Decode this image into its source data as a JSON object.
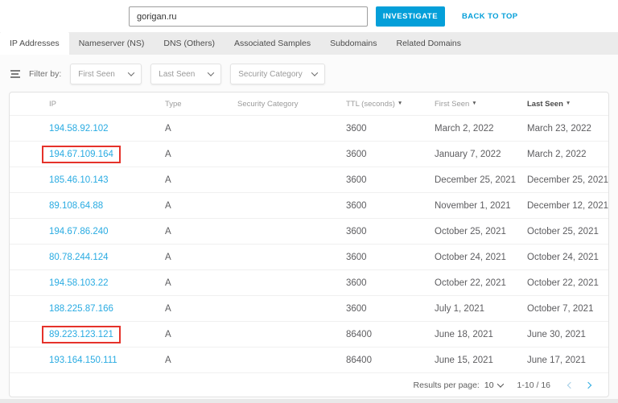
{
  "topbar": {
    "search_value": "gorigan.ru",
    "investigate_label": "INVESTIGATE",
    "back_to_top_label": "BACK TO TOP"
  },
  "tabs": [
    {
      "label": "IP Addresses",
      "active": true
    },
    {
      "label": "Nameserver (NS)",
      "active": false
    },
    {
      "label": "DNS (Others)",
      "active": false
    },
    {
      "label": "Associated Samples",
      "active": false
    },
    {
      "label": "Subdomains",
      "active": false
    },
    {
      "label": "Related Domains",
      "active": false
    }
  ],
  "filters": {
    "label": "Filter by:",
    "dropdowns": [
      "First Seen",
      "Last Seen",
      "Security Category"
    ]
  },
  "table": {
    "columns": [
      {
        "label": "IP",
        "sortable": false,
        "active_sort": false
      },
      {
        "label": "Type",
        "sortable": false,
        "active_sort": false
      },
      {
        "label": "Security Category",
        "sortable": false,
        "active_sort": false
      },
      {
        "label": "TTL (seconds)",
        "sortable": true,
        "active_sort": false
      },
      {
        "label": "First Seen",
        "sortable": true,
        "active_sort": false
      },
      {
        "label": "Last Seen",
        "sortable": true,
        "active_sort": true
      }
    ],
    "rows": [
      {
        "ip": "194.58.92.102",
        "type": "A",
        "security_category": "",
        "ttl": "3600",
        "first_seen": "March 2, 2022",
        "last_seen": "March 23, 2022",
        "highlighted": false
      },
      {
        "ip": "194.67.109.164",
        "type": "A",
        "security_category": "",
        "ttl": "3600",
        "first_seen": "January 7, 2022",
        "last_seen": "March 2, 2022",
        "highlighted": true
      },
      {
        "ip": "185.46.10.143",
        "type": "A",
        "security_category": "",
        "ttl": "3600",
        "first_seen": "December 25, 2021",
        "last_seen": "December 25, 2021",
        "highlighted": false
      },
      {
        "ip": "89.108.64.88",
        "type": "A",
        "security_category": "",
        "ttl": "3600",
        "first_seen": "November 1, 2021",
        "last_seen": "December 12, 2021",
        "highlighted": false
      },
      {
        "ip": "194.67.86.240",
        "type": "A",
        "security_category": "",
        "ttl": "3600",
        "first_seen": "October 25, 2021",
        "last_seen": "October 25, 2021",
        "highlighted": false
      },
      {
        "ip": "80.78.244.124",
        "type": "A",
        "security_category": "",
        "ttl": "3600",
        "first_seen": "October 24, 2021",
        "last_seen": "October 24, 2021",
        "highlighted": false
      },
      {
        "ip": "194.58.103.22",
        "type": "A",
        "security_category": "",
        "ttl": "3600",
        "first_seen": "October 22, 2021",
        "last_seen": "October 22, 2021",
        "highlighted": false
      },
      {
        "ip": "188.225.87.166",
        "type": "A",
        "security_category": "",
        "ttl": "3600",
        "first_seen": "July 1, 2021",
        "last_seen": "October 7, 2021",
        "highlighted": false
      },
      {
        "ip": "89.223.123.121",
        "type": "A",
        "security_category": "",
        "ttl": "86400",
        "first_seen": "June 18, 2021",
        "last_seen": "June 30, 2021",
        "highlighted": true
      },
      {
        "ip": "193.164.150.111",
        "type": "A",
        "security_category": "",
        "ttl": "86400",
        "first_seen": "June 15, 2021",
        "last_seen": "June 17, 2021",
        "highlighted": false
      }
    ]
  },
  "pagination": {
    "results_per_page_label": "Results per page:",
    "results_per_page_value": "10",
    "range": "1-10 / 16"
  },
  "colors": {
    "accent": "#049fd9",
    "link": "#29abe2",
    "highlight_border": "#e5322a"
  }
}
